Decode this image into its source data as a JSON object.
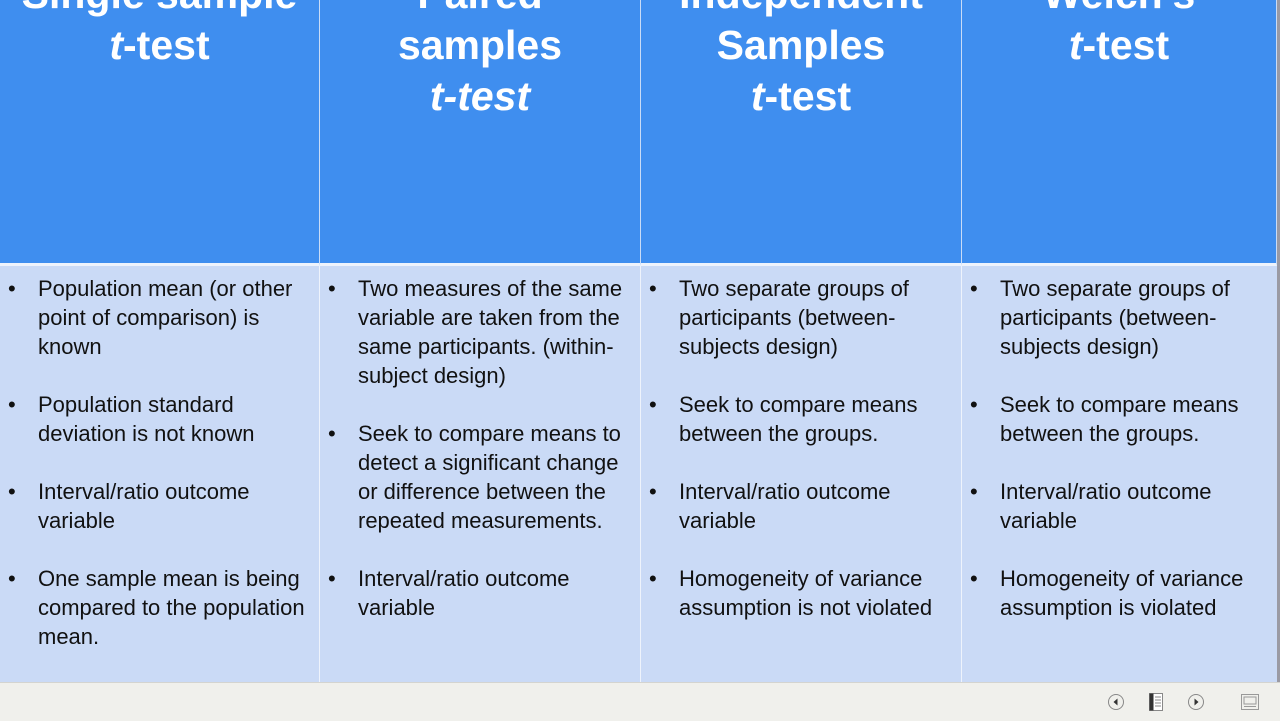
{
  "slide": {
    "columns": [
      {
        "title_lines": [
          {
            "pre": "",
            "italic": "",
            "post": "Single sample"
          },
          {
            "pre": "",
            "italic": "t",
            "post": "-test"
          }
        ],
        "bullets": [
          "Population mean (or other point of comparison) is known",
          "Population standard deviation is not known",
          "Interval/ratio outcome variable",
          "One sample mean is being compared to the population mean."
        ]
      },
      {
        "title_lines": [
          {
            "pre": "",
            "italic": "",
            "post": "Paired"
          },
          {
            "pre": "",
            "italic": "",
            "post": "samples"
          },
          {
            "pre": "",
            "italic": "t-test",
            "post": ""
          }
        ],
        "bullets": [
          "Two measures of the same variable are taken from the same participants. (within-subject design)",
          "Seek to compare means to detect a significant change or difference between the repeated measurements.",
          "Interval/ratio outcome variable"
        ]
      },
      {
        "title_lines": [
          {
            "pre": "",
            "italic": "",
            "post": "Independent"
          },
          {
            "pre": "",
            "italic": "",
            "post": "Samples"
          },
          {
            "pre": "",
            "italic": "t",
            "post": "-test"
          }
        ],
        "bullets": [
          "Two separate groups of participants (between-subjects design)",
          "Seek to compare means between the groups.",
          "Interval/ratio outcome variable",
          "Homogeneity of variance assumption is not violated"
        ]
      },
      {
        "title_lines": [
          {
            "pre": "",
            "italic": "",
            "post": "Welch's"
          },
          {
            "pre": "",
            "italic": "t",
            "post": "-test"
          }
        ],
        "bullets": [
          "Two separate groups of participants (between-subjects design)",
          "Seek to compare means between the groups.",
          "Interval/ratio outcome variable",
          "Homogeneity of variance assumption is violated"
        ]
      }
    ],
    "bullet_glyph": "•"
  },
  "statusbar": {
    "icons": [
      "previous-slide-icon",
      "notes-view-icon",
      "next-slide-icon",
      "slide-view-icon"
    ]
  },
  "colors": {
    "header_bg": "#3f8eef",
    "body_bg": "#cadaf6",
    "header_text": "#ffffff",
    "body_text": "#111111"
  }
}
